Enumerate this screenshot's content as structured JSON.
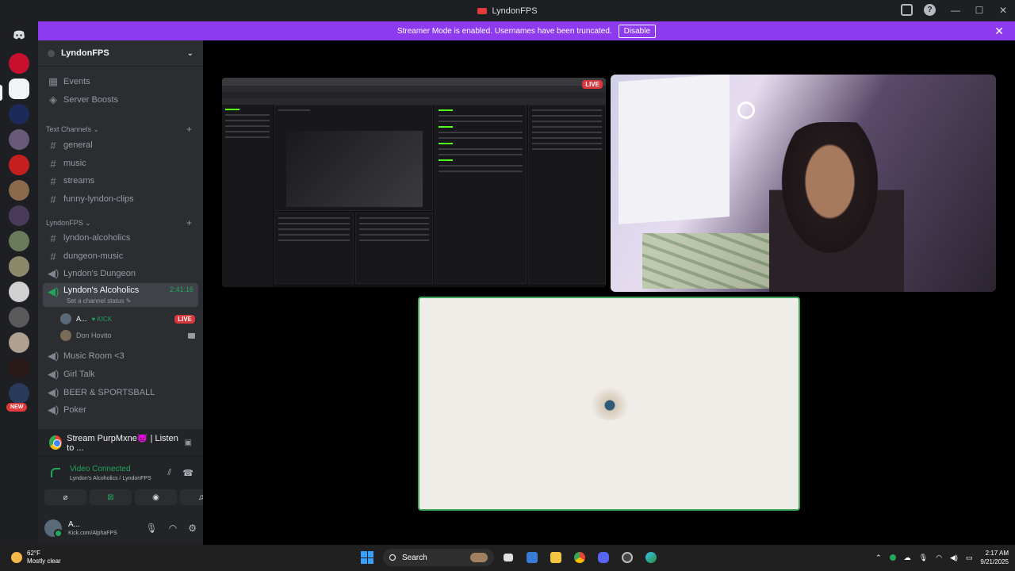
{
  "window": {
    "title": "LyndonFPS"
  },
  "banner": {
    "text": "Streamer Mode is enabled. Usernames have been truncated.",
    "button": "Disable"
  },
  "guilds": {
    "new_badge": "NEW"
  },
  "server": {
    "name": "LyndonFPS"
  },
  "top_items": [
    {
      "label": "Events",
      "icon": "calendar-icon"
    },
    {
      "label": "Server Boosts",
      "icon": "boost-icon"
    }
  ],
  "categories": {
    "text": "Text Channels",
    "lyndonfps": "LyndonFPS"
  },
  "text_channels": [
    "general",
    "music",
    "streams",
    "funny-lyndon-clips"
  ],
  "lyndon_channels": [
    {
      "label": "lyndon-alcoholics",
      "type": "text"
    },
    {
      "label": "dungeon-music",
      "type": "text"
    },
    {
      "label": "Lyndon's Dungeon",
      "type": "voice"
    }
  ],
  "active_voice": {
    "label": "Lyndon's Alcoholics",
    "time": "2:41:16",
    "status": "Set a channel status",
    "users": [
      {
        "name": "A...",
        "tag": "KICK",
        "badge": "LIVE"
      },
      {
        "name": "Don Hovito"
      }
    ]
  },
  "voice_channels": [
    "Music Room <3",
    "Girl Talk",
    "BEER & SPORTSBALL",
    "Poker"
  ],
  "activity": {
    "text": "Stream PurpMxne👿 | Listen to ..."
  },
  "voice_panel": {
    "title": "Video Connected",
    "sub": "Lyndon's Alcoholics / LyndonFPS"
  },
  "user": {
    "name": "A...",
    "status": "Kick.com/AlphaFPS"
  },
  "stage": {
    "live_label": "LIVE"
  },
  "taskbar": {
    "temp": "62°F",
    "weather": "Mostly clear",
    "search": "Search",
    "time": "2:17 AM",
    "date": "9/21/2025"
  },
  "colors": {
    "accent": "#8e3bf0",
    "online": "#23a55a",
    "live": "#da373c",
    "kick_green": "#53fc18"
  }
}
